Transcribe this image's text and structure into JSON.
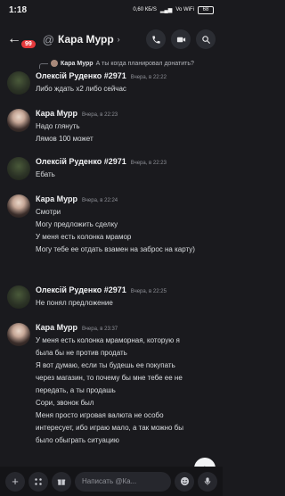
{
  "status_bar": {
    "time": "1:18",
    "signal_text": "0,60 КБ/S",
    "network": "Vo WiFi",
    "battery": "68"
  },
  "header": {
    "unread_badge": "99",
    "channel_title": "Кара Мурр",
    "icons": [
      "phone-icon",
      "video-icon",
      "search-icon"
    ]
  },
  "reply_preview": {
    "author": "Кара Мурр",
    "text": "А ты когда планировал донатить?"
  },
  "messages": [
    {
      "author": "Олексій Руденко #2971",
      "time": "Вчера, в 22:22",
      "avatar": "olex",
      "lines": [
        "Либо ждать х2 либо сейчас"
      ]
    },
    {
      "author": "Кара Мурр",
      "time": "Вчера, в 22:23",
      "avatar": "kara",
      "lines": [
        "Надо глянуть",
        "Лямов 100 может"
      ]
    },
    {
      "author": "Олексій Руденко #2971",
      "time": "Вчера, в 22:23",
      "avatar": "olex",
      "lines": [
        "Ебать"
      ]
    },
    {
      "author": "Кара Мурр",
      "time": "Вчера, в 22:24",
      "avatar": "kara",
      "lines": [
        "Смотри",
        "Могу предложить сделку",
        "У меня есть колонка мрамор",
        "Могу тебе ее отдать взамен на  заброс на карту)"
      ]
    },
    {
      "author": "Олексій Руденко #2971",
      "time": "Вчера, в 22:25",
      "avatar": "olex",
      "lines": [
        "Не понял предложение"
      ]
    },
    {
      "author": "Кара Мурр",
      "time": "Вчера, в 23:37",
      "avatar": "kara",
      "lines": [
        "У меня есть колонка мраморная, которую я была бы не против продать",
        "Я вот думаю, если ты будешь ее покупать через магазин, то почему бы мне тебе ее не передать, а ты продашь",
        "Сори, звонок был",
        "Меня просто игровая валюта не особо интересует, ибо играю мало, а так можно бы было обыграть ситуацию"
      ]
    }
  ],
  "composer": {
    "placeholder": "Написать @Ка...",
    "buttons": [
      "plus-icon",
      "apps-icon",
      "gift-icon",
      "emoji-icon",
      "mic-icon"
    ]
  },
  "jump_button": {
    "icon": "arrow-down-icon"
  }
}
